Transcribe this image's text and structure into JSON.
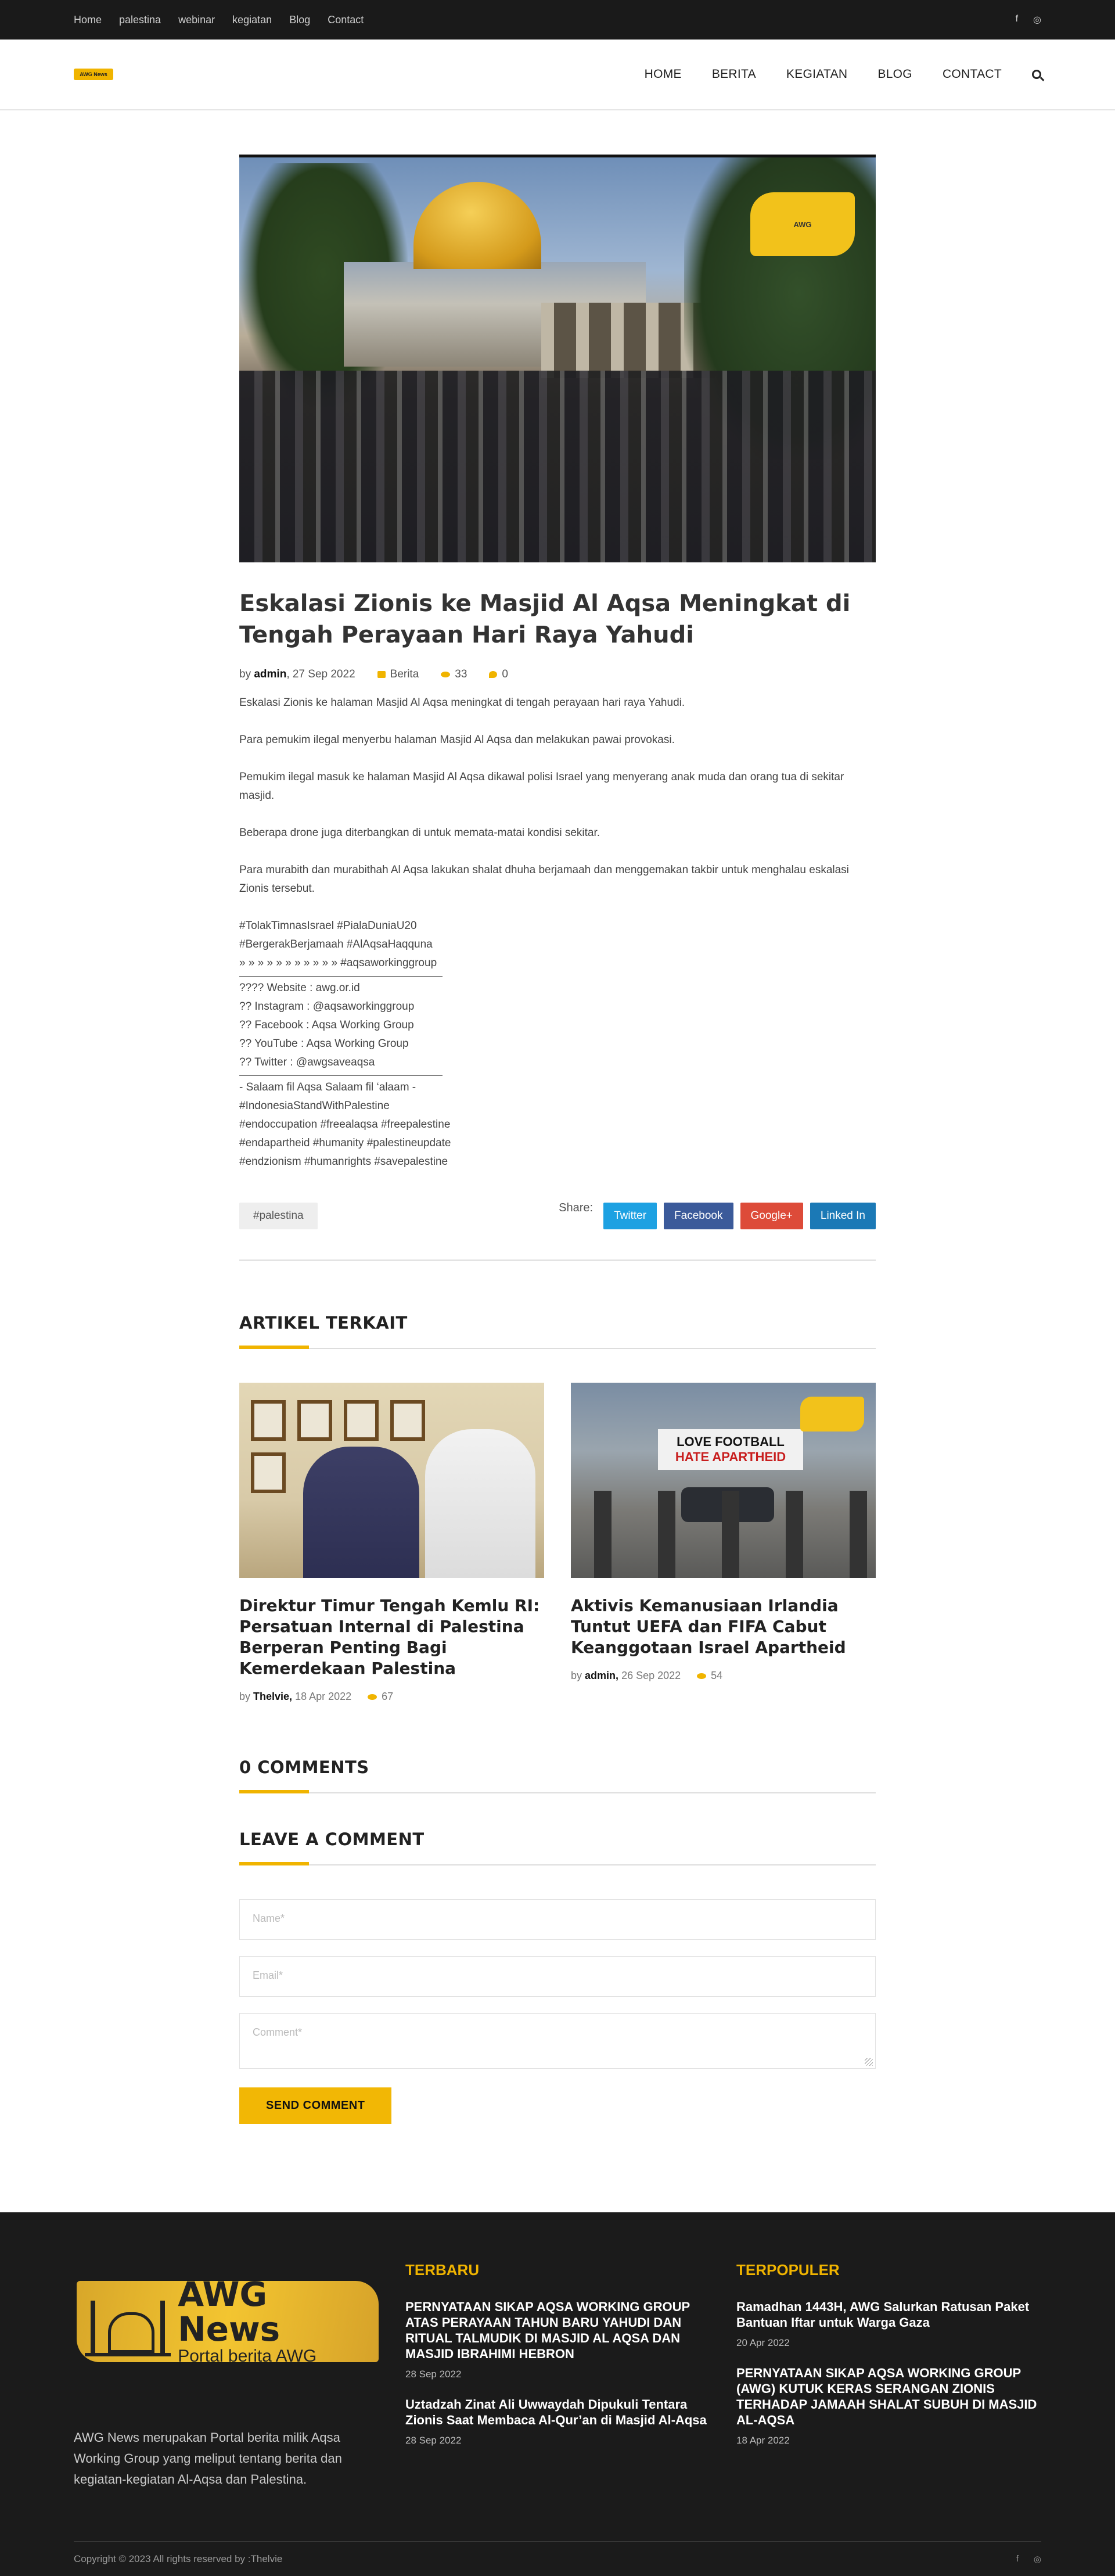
{
  "topbar": {
    "links": [
      "Home",
      "palestina",
      "webinar",
      "kegiatan",
      "Blog",
      "Contact"
    ],
    "social": [
      "f",
      "◎"
    ]
  },
  "header": {
    "logo_text": "AWG News",
    "nav": [
      "HOME",
      "BERITA",
      "KEGIATAN",
      "BLOG",
      "CONTACT"
    ]
  },
  "article": {
    "title": "Eskalasi Zionis ke Masjid Al Aqsa Meningkat di Tengah Perayaan Hari Raya Yahudi",
    "meta": {
      "by": "by",
      "author": "admin",
      "date": ", 27 Sep 2022",
      "category": "Berita",
      "views": "33",
      "comments": "0"
    },
    "paragraphs": [
      "Eskalasi Zionis ke halaman Masjid Al Aqsa meningkat di tengah perayaan hari raya Yahudi.",
      "Para pemukim ilegal menyerbu halaman Masjid Al Aqsa dan melakukan pawai provokasi.",
      "Pemukim ilegal masuk ke halaman Masjid Al Aqsa dikawal polisi Israel yang menyerang anak muda dan orang tua di sekitar masjid.",
      "Beberapa drone juga diterbangkan di untuk memata-matai kondisi sekitar.",
      "Para murabith dan murabithah Al Aqsa lakukan shalat dhuha berjamaah dan menggemakan takbir untuk menghalau eskalasi Zionis tersebut."
    ],
    "hashtags": [
      "#TolakTimnasIsrael #PialaDuniaU20",
      "#BergerakBerjamaah #AlAqsaHaqquna",
      "» » » » » » » » » » » #aqsaworkinggroup"
    ],
    "contacts": [
      "???? Website : awg.or.id",
      "?? Instagram : @aqsaworkinggroup",
      "?? Facebook : Aqsa Working Group",
      "?? YouTube : Aqsa Working Group",
      "?? Twitter : @awgsaveaqsa"
    ],
    "closing": [
      "- Salaam fil Aqsa Salaam fil ‘alaam -",
      "#IndonesiaStandWithPalestine",
      "#endoccupation #freealaqsa #freepalestine",
      "#endapartheid #humanity #palestineupdate",
      "#endzionism #humanrights #savepalestine"
    ],
    "tag": "#palestina",
    "share_label": "Share:",
    "share": [
      {
        "label": "Twitter",
        "color": "#1da1e2"
      },
      {
        "label": "Facebook",
        "color": "#3b5a9a"
      },
      {
        "label": "Google+",
        "color": "#dd4b39"
      },
      {
        "label": "Linked In",
        "color": "#1b79b6"
      }
    ],
    "hero_badge": "AWG"
  },
  "related": {
    "title": "ARTIKEL TERKAIT",
    "items": [
      {
        "title": "Direktur Timur Tengah Kemlu RI: Persatuan Internal di Palestina Berperan Penting Bagi Kemerdekaan Palestina",
        "by": "by",
        "author": "Thelvie,",
        "date": "18 Apr 2022",
        "views": "67"
      },
      {
        "title": "Aktivis Kemanusiaan Irlandia Tuntut UEFA dan FIFA Cabut Keanggotaan Israel Apartheid",
        "by": "by",
        "author": "admin,",
        "date": "26 Sep 2022",
        "views": "54",
        "banner_1": "LOVE FOOTBALL",
        "banner_2": "HATE APARTHEID"
      }
    ]
  },
  "comments": {
    "count_title": "0 COMMENTS",
    "leave_title": "LEAVE A COMMENT",
    "name_placeholder": "Name*",
    "email_placeholder": "Email*",
    "comment_placeholder": "Comment*",
    "submit": "SEND COMMENT"
  },
  "footer": {
    "logo_big": "AWG News",
    "logo_small": "Portal berita AWG",
    "description": "AWG News merupakan Portal berita milik Aqsa Working Group yang meliput tentang berita dan kegiatan-kegiatan Al-Aqsa dan Palestina.",
    "terbaru": {
      "title": "TERBARU",
      "items": [
        {
          "title": "PERNYATAAN SIKAP AQSA WORKING GROUP ATAS PERAYAAN TAHUN BARU YAHUDI DAN RITUAL TALMUDIK DI MASJID AL AQSA DAN MASJID IBRAHIMI HEBRON",
          "date": "28 Sep 2022"
        },
        {
          "title": "Uztadzah Zinat Ali Uwwaydah Dipukuli Tentara Zionis Saat Membaca Al-Qur’an di Masjid Al-Aqsa",
          "date": "28 Sep 2022"
        }
      ]
    },
    "terpopuler": {
      "title": "TERPOPULER",
      "items": [
        {
          "title": "Ramadhan 1443H, AWG Salurkan Ratusan Paket Bantuan Iftar untuk Warga Gaza",
          "date": "20 Apr 2022"
        },
        {
          "title": "PERNYATAAN SIKAP AQSA WORKING GROUP (AWG) KUTUK KERAS SERANGAN ZIONIS TERHADAP JAMAAH SHALAT SUBUH DI MASJID AL-AQSA",
          "date": "18 Apr 2022"
        }
      ]
    },
    "copyright": "Copyright © 2023 All rights reserved by :Thelvie",
    "social": [
      "f",
      "◎"
    ]
  }
}
